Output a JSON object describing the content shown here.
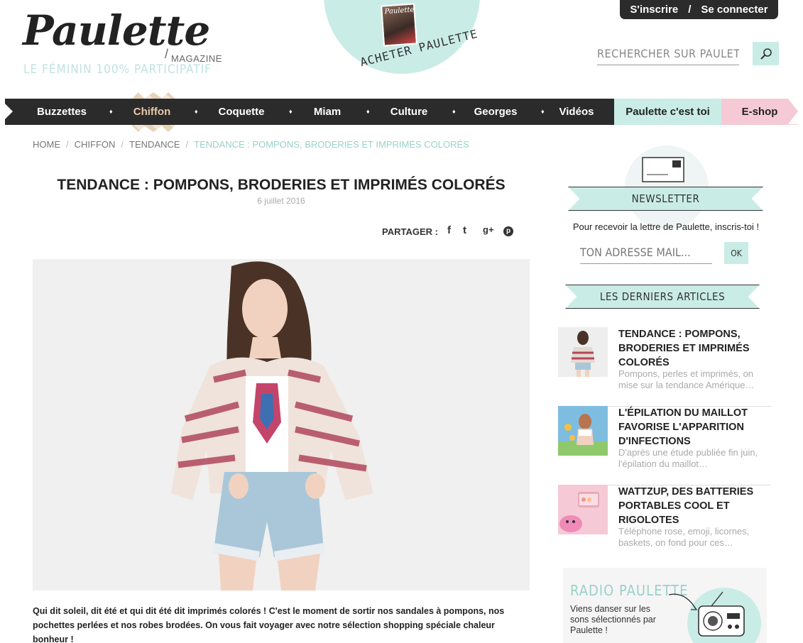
{
  "header": {
    "logo": "Paulette",
    "logo_slash": "/",
    "logo_sub": "MAGAZINE",
    "tagline": "LE FÉMININ 100% PARTICIPATIF",
    "buy_label": "ACHETER PAULETTE",
    "buy_mag_title": "Paulette",
    "auth": {
      "signup": "S'inscrire",
      "sep": "/",
      "login": "Se connecter"
    },
    "search_placeholder": "RECHERCHER SUR PAULETTE",
    "search_icon": "magnifier-icon"
  },
  "nav": {
    "items": [
      "Buzzettes",
      "Chiffon",
      "Coquette",
      "Miam",
      "Culture",
      "Georges",
      "Vidéos"
    ],
    "separator": "♦",
    "active": "Chiffon",
    "special": [
      "Paulette c'est toi",
      "E-shop"
    ]
  },
  "breadcrumb": [
    "HOME",
    "CHIFFON",
    "TENDANCE",
    "TENDANCE : POMPONS, BRODERIES ET IMPRIMÉS COLORÉS"
  ],
  "breadcrumb_sep": "/",
  "article": {
    "title": "TENDANCE : POMPONS, BRODERIES ET IMPRIMÉS COLORÉS",
    "date": "6 juillet 2016",
    "share_label": "PARTAGER :",
    "share_icons": [
      "facebook-icon",
      "twitter-icon",
      "google-plus-icon",
      "pinterest-icon"
    ],
    "share_glyphs": [
      "f",
      "t",
      "g+",
      "p"
    ],
    "intro": "Qui dit soleil, dit été et qui dit été dit imprimés colorés ! C'est le moment de sortir nos sandales à pompons, nos pochettes perlées et nos robes brodées. On vous fait voyager avec notre sélection shopping spéciale chaleur bonheur !"
  },
  "sidebar": {
    "newsletter_title": "NEWSLETTER",
    "newsletter_text": "Pour recevoir la lettre de Paulette, inscris-toi !",
    "email_placeholder": "TON ADRESSE MAIL...",
    "ok_label": "OK",
    "latest_title": "LES DERNIERS ARTICLES",
    "articles": [
      {
        "title": "TENDANCE : POMPONS, BRODERIES ET IMPRIMÉS COLORÉS",
        "excerpt": "Pompons, perles et imprimés, on mise sur la tendance Amérique…"
      },
      {
        "title": "L'ÉPILATION DU MAILLOT FAVORISE L'APPARITION D'INFECTIONS",
        "excerpt": "D'après une étude publiée fin juin, l'épilation du maillot…"
      },
      {
        "title": "WATTZUP, DES BATTERIES PORTABLES COOL ET RIGOLOTES",
        "excerpt": "Téléphone rose, emoji, licornes, baskets, on fond pour ces…"
      }
    ],
    "radio_title": "RADIO PAULETTE",
    "radio_text": "Viens danser sur les sons sélectionnés par Paulette !"
  },
  "colors": {
    "mint": "#c9ece6",
    "pink": "#f5cad6",
    "dark": "#2b2b2b",
    "beige": "#e8c9a6"
  }
}
